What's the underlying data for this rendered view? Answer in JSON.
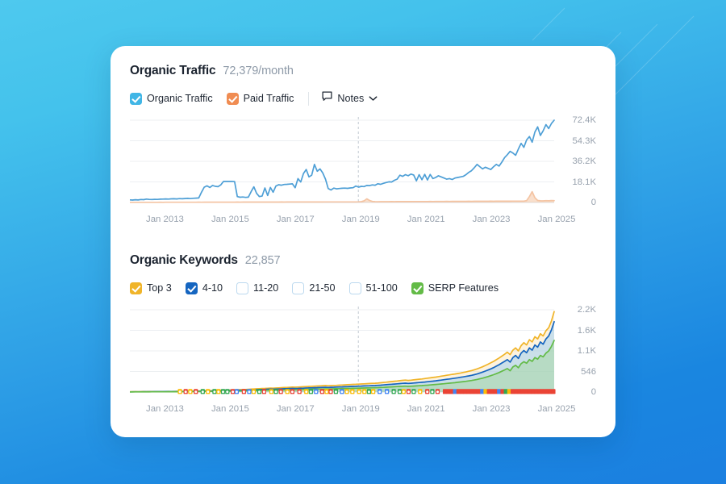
{
  "background": {
    "gradient_from": "#4ec9ee",
    "gradient_to": "#1b7fe0"
  },
  "card": {
    "traffic": {
      "title": "Organic Traffic",
      "value": "72,379/month",
      "legend": [
        {
          "label": "Organic Traffic",
          "checked": true,
          "color": "#41b6e6"
        },
        {
          "label": "Paid Traffic",
          "checked": true,
          "color": "#f08c52"
        }
      ],
      "notes_label": "Notes"
    },
    "keywords": {
      "title": "Organic Keywords",
      "value": "22,857",
      "legend": [
        {
          "label": "Top 3",
          "checked": true,
          "color": "#f0b429"
        },
        {
          "label": "4-10",
          "checked": true,
          "color": "#1565c0"
        },
        {
          "label": "11-20",
          "checked": false,
          "color": "#ffffff"
        },
        {
          "label": "21-50",
          "checked": false,
          "color": "#ffffff"
        },
        {
          "label": "51-100",
          "checked": false,
          "color": "#ffffff"
        },
        {
          "label": "SERP Features",
          "checked": true,
          "color": "#63bb47"
        }
      ]
    }
  },
  "chart_data": [
    {
      "type": "area",
      "title": "Organic Traffic",
      "xlabel": "",
      "ylabel": "",
      "grid": true,
      "legend_position": "top",
      "annotation_line_x": "Jan 2019",
      "xticks": [
        "Jan 2013",
        "Jan 2015",
        "Jan 2017",
        "Jan 2019",
        "Jan 2021",
        "Jan 2023",
        "Jan 2025"
      ],
      "yticks": [
        "0",
        "18.1K",
        "36.2K",
        "54.3K",
        "72.4K"
      ],
      "ylim": [
        0,
        72400
      ],
      "x_start": "Jan 2012",
      "x_end": "Jan 2025",
      "series": [
        {
          "name": "Organic Traffic",
          "color": "#4e9fd6",
          "values": [
            2300,
            2100,
            2400,
            2200,
            2600,
            2500,
            3000,
            2700,
            2600,
            2800,
            2700,
            2900,
            3000,
            3100,
            3000,
            3200,
            3300,
            3100,
            3400,
            3300,
            3500,
            3600,
            3400,
            3700,
            3800,
            4000,
            9000,
            13500,
            14600,
            13200,
            15000,
            14200,
            13900,
            15500,
            18500,
            18600,
            18500,
            18600,
            18400,
            5200,
            4600,
            4800,
            4500,
            4700,
            9500,
            13800,
            8000,
            5200,
            5600,
            12800,
            6200,
            13200,
            9000,
            14500,
            15600,
            15200,
            15800,
            16000,
            16200,
            16400,
            13000,
            21000,
            18000,
            25500,
            29000,
            22500,
            24000,
            33500,
            27500,
            29500,
            26000,
            20500,
            12200,
            11000,
            12600,
            12000,
            12300,
            12500,
            12600,
            12400,
            12800,
            13000,
            14500,
            13500,
            14200,
            14000,
            15000,
            14800,
            15500,
            15200,
            16500,
            16000,
            16800,
            17500,
            18200,
            18000,
            19500,
            20500,
            24000,
            23000,
            24500,
            23500,
            25000,
            24200,
            19000,
            24500,
            20000,
            24800,
            19800,
            24600,
            21000,
            22000,
            23500,
            22500,
            21500,
            20500,
            21000,
            20200,
            21500,
            22000,
            22500,
            23000,
            24500,
            26500,
            28000,
            30500,
            33500,
            31500,
            29500,
            31000,
            30000,
            29000,
            31500,
            33500,
            32000,
            35500,
            39500,
            42000,
            45000,
            43500,
            41500,
            47000,
            52000,
            48500,
            55000,
            58000,
            53000,
            62000,
            66500,
            59000,
            63000,
            68500,
            65000,
            69500,
            72379
          ]
        },
        {
          "name": "Paid Traffic",
          "color": "#f4c4a3",
          "values": [
            120,
            130,
            110,
            140,
            130,
            150,
            140,
            160,
            150,
            170,
            160,
            180,
            170,
            190,
            180,
            200,
            190,
            210,
            200,
            220,
            210,
            230,
            220,
            240,
            230,
            250,
            240,
            260,
            250,
            270,
            260,
            280,
            270,
            290,
            280,
            300,
            290,
            310,
            300,
            320,
            310,
            330,
            320,
            340,
            330,
            350,
            340,
            360,
            350,
            370,
            360,
            380,
            370,
            390,
            380,
            400,
            390,
            410,
            400,
            420,
            410,
            430,
            420,
            440,
            430,
            450,
            440,
            460,
            450,
            470,
            460,
            480,
            470,
            490,
            480,
            500,
            490,
            510,
            500,
            520,
            510,
            530,
            520,
            540,
            700,
            1400,
            3200,
            1800,
            900,
            700,
            650,
            700,
            680,
            720,
            700,
            760,
            740,
            780,
            760,
            800,
            780,
            820,
            800,
            840,
            820,
            860,
            840,
            880,
            860,
            900,
            880,
            920,
            900,
            940,
            920,
            960,
            940,
            980,
            960,
            1000,
            980,
            1020,
            1000,
            1040,
            1020,
            1060,
            1040,
            1080,
            1060,
            1100,
            1080,
            1120,
            1100,
            1140,
            1120,
            1160,
            1140,
            1180,
            1160,
            1200,
            1180,
            1220,
            1200,
            1240,
            1600,
            5200,
            9500,
            4200,
            1800,
            1500,
            1400,
            1600,
            1500,
            1700,
            1650
          ]
        }
      ]
    },
    {
      "type": "area",
      "title": "Organic Keywords",
      "xlabel": "",
      "ylabel": "",
      "grid": true,
      "legend_position": "top",
      "annotation_line_x": "Jan 2019",
      "xticks": [
        "Jan 2013",
        "Jan 2015",
        "Jan 2017",
        "Jan 2019",
        "Jan 2021",
        "Jan 2023",
        "Jan 2025"
      ],
      "yticks": [
        "0",
        "546",
        "1.1K",
        "1.6K",
        "2.2K"
      ],
      "ylim": [
        0,
        2200
      ],
      "x_start": "Jan 2012",
      "x_end": "Jan 2025",
      "series": [
        {
          "name": "Top 3",
          "color": "#f0b429",
          "values": [
            8,
            9,
            10,
            9,
            11,
            12,
            11,
            13,
            12,
            14,
            13,
            15,
            16,
            15,
            17,
            16,
            18,
            19,
            18,
            20,
            22,
            21,
            23,
            25,
            26,
            28,
            30,
            32,
            34,
            36,
            38,
            40,
            42,
            44,
            46,
            48,
            52,
            56,
            60,
            64,
            62,
            66,
            70,
            74,
            78,
            82,
            86,
            90,
            94,
            98,
            102,
            106,
            104,
            108,
            112,
            116,
            120,
            124,
            128,
            132,
            130,
            134,
            138,
            142,
            146,
            150,
            154,
            158,
            162,
            166,
            170,
            174,
            168,
            172,
            176,
            180,
            184,
            188,
            192,
            196,
            200,
            204,
            208,
            212,
            216,
            220,
            224,
            228,
            232,
            236,
            240,
            248,
            256,
            264,
            272,
            280,
            288,
            296,
            304,
            312,
            320,
            310,
            318,
            326,
            334,
            342,
            350,
            360,
            370,
            380,
            390,
            400,
            412,
            424,
            436,
            448,
            460,
            472,
            484,
            496,
            510,
            524,
            538,
            556,
            574,
            596,
            620,
            648,
            676,
            710,
            744,
            780,
            820,
            864,
            910,
            960,
            1010,
            1065,
            1000,
            1120,
            1180,
            1100,
            1240,
            1320,
            1260,
            1400,
            1340,
            1480,
            1420,
            1560,
            1500,
            1640,
            1720,
            1900,
            2150
          ]
        },
        {
          "name": "4-10",
          "color": "#1565c0",
          "values": [
            5,
            6,
            6,
            7,
            7,
            8,
            8,
            9,
            9,
            10,
            10,
            11,
            11,
            12,
            12,
            13,
            13,
            14,
            14,
            15,
            16,
            17,
            18,
            19,
            20,
            21,
            22,
            24,
            25,
            27,
            28,
            30,
            31,
            33,
            34,
            36,
            38,
            41,
            44,
            47,
            45,
            48,
            51,
            54,
            57,
            60,
            63,
            66,
            69,
            72,
            75,
            78,
            76,
            79,
            82,
            85,
            88,
            91,
            94,
            97,
            95,
            98,
            101,
            104,
            107,
            110,
            113,
            116,
            119,
            122,
            125,
            128,
            124,
            127,
            130,
            133,
            136,
            139,
            142,
            145,
            148,
            151,
            154,
            157,
            160,
            163,
            166,
            169,
            172,
            175,
            178,
            184,
            190,
            196,
            202,
            208,
            214,
            220,
            226,
            232,
            238,
            230,
            236,
            242,
            248,
            254,
            260,
            268,
            276,
            284,
            292,
            300,
            310,
            320,
            330,
            340,
            350,
            360,
            370,
            382,
            394,
            406,
            418,
            432,
            446,
            464,
            484,
            508,
            532,
            560,
            588,
            620,
            654,
            692,
            732,
            776,
            820,
            868,
            800,
            920,
            980,
            900,
            1040,
            1110,
            1050,
            1180,
            1120,
            1260,
            1200,
            1340,
            1280,
            1420,
            1500,
            1660,
            1880
          ]
        },
        {
          "name": "SERP Features",
          "color": "#63bb47",
          "values": [
            3,
            3,
            4,
            4,
            4,
            5,
            5,
            5,
            6,
            6,
            6,
            7,
            7,
            7,
            8,
            8,
            8,
            9,
            9,
            10,
            10,
            11,
            11,
            12,
            13,
            13,
            14,
            15,
            16,
            17,
            18,
            19,
            20,
            21,
            22,
            23,
            24,
            26,
            28,
            30,
            29,
            31,
            33,
            35,
            37,
            39,
            41,
            43,
            45,
            47,
            49,
            51,
            50,
            52,
            54,
            56,
            58,
            60,
            62,
            64,
            63,
            65,
            67,
            69,
            71,
            73,
            75,
            77,
            79,
            81,
            83,
            85,
            82,
            84,
            86,
            88,
            90,
            92,
            94,
            96,
            98,
            100,
            102,
            104,
            106,
            108,
            110,
            112,
            114,
            116,
            118,
            122,
            126,
            130,
            134,
            138,
            142,
            146,
            150,
            154,
            158,
            152,
            156,
            160,
            164,
            168,
            172,
            178,
            184,
            190,
            196,
            202,
            209,
            216,
            223,
            230,
            237,
            244,
            251,
            260,
            269,
            278,
            287,
            298,
            309,
            322,
            337,
            354,
            372,
            392,
            414,
            438,
            464,
            492,
            522,
            556,
            590,
            628,
            570,
            670,
            714,
            650,
            760,
            812,
            770,
            866,
            820,
            922,
            880,
            980,
            940,
            1040,
            1100,
            1220,
            1380
          ]
        }
      ]
    }
  ]
}
